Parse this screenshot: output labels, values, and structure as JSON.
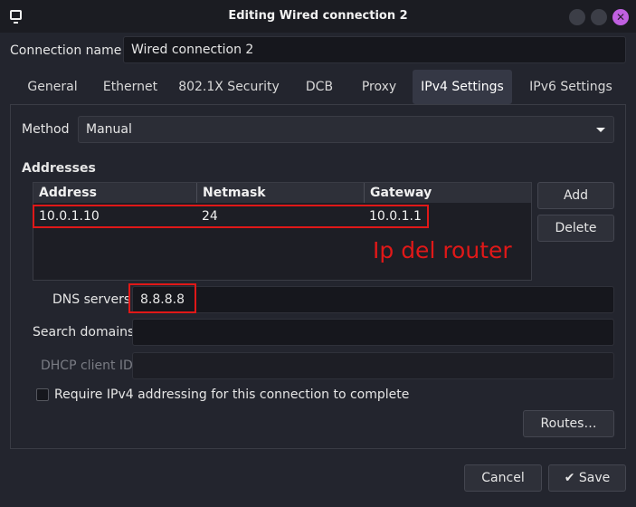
{
  "window": {
    "title": "Editing Wired connection 2"
  },
  "connection": {
    "name_label": "Connection name",
    "name_value": "Wired connection 2"
  },
  "tabs": [
    {
      "label": "General"
    },
    {
      "label": "Ethernet"
    },
    {
      "label": "802.1X Security"
    },
    {
      "label": "DCB"
    },
    {
      "label": "Proxy"
    },
    {
      "label": "IPv4 Settings"
    },
    {
      "label": "IPv6 Settings"
    }
  ],
  "active_tab": "IPv4 Settings",
  "ipv4": {
    "method_label": "Method",
    "method_value": "Manual",
    "addresses_heading": "Addresses",
    "columns": [
      "Address",
      "Netmask",
      "Gateway"
    ],
    "rows": [
      [
        "10.0.1.10",
        "24",
        "10.0.1.1"
      ]
    ],
    "add_label": "Add",
    "delete_label": "Delete",
    "annotation": "Ip del router",
    "dns_label": "DNS servers",
    "dns_value": "8.8.8.8",
    "search_domains_label": "Search domains",
    "search_domains_value": "",
    "dhcp_client_id_label": "DHCP client ID",
    "dhcp_client_id_value": "",
    "require_label": "Require IPv4 addressing for this connection to complete",
    "require_checked": false,
    "routes_label": "Routes…"
  },
  "footer": {
    "cancel_label": "Cancel",
    "save_label": "Save"
  },
  "colors": {
    "annotation_red": "#e01818",
    "close_button": "#c060e0",
    "background": "#23252e"
  }
}
